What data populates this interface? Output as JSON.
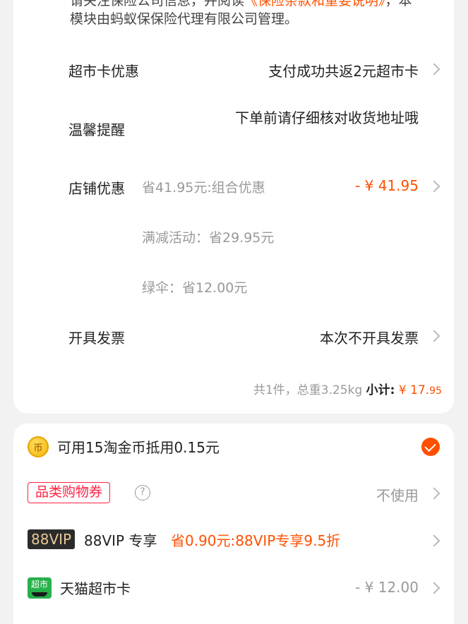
{
  "notice": {
    "text_before": "请关注保险公司信息，并阅读",
    "link": "《保险条款和重要说明》",
    "text_after": "，本模块由蚂蚁保保险代理有限公司管理。"
  },
  "rows": {
    "supermarket_card": {
      "label": "超市卡优惠",
      "value": "支付成功共返2元超市卡"
    },
    "reminder": {
      "label": "温馨提醒",
      "value": "下单前请仔细核对收货地址哦"
    },
    "store_discount": {
      "label": "店铺优惠",
      "desc": "省41.95元:组合优惠",
      "amount": "- ¥ 41.95",
      "sub1": "满减活动：省29.95元",
      "sub2": "绿伞：省12.00元"
    },
    "invoice": {
      "label": "开具发票",
      "value": "本次不开具发票"
    }
  },
  "summary": {
    "count_weight": "共1件，总重3.25kg",
    "subtotal_label": "小计:",
    "currency": "¥",
    "amount_int": "17.",
    "amount_dec": "95"
  },
  "benefits": {
    "coin": {
      "icon_char": "币",
      "text": "可用15淘金币抵用0.15元"
    },
    "category_coupon": {
      "tag": "品类购物券",
      "help": "?",
      "value": "不使用"
    },
    "vip": {
      "badge": "88VIP",
      "label": "88VIP 专享",
      "saving": "省0.90元:88VIP专享9.5折"
    },
    "tmall_card": {
      "icon_text": "超市",
      "label": "天猫超市卡",
      "value": "- ¥ 12.00"
    }
  },
  "colors": {
    "accent": "#ff5000",
    "coupon_red": "#ff2244",
    "vip_bg": "#2b2b2b",
    "tmall_green": "#27b04b"
  }
}
